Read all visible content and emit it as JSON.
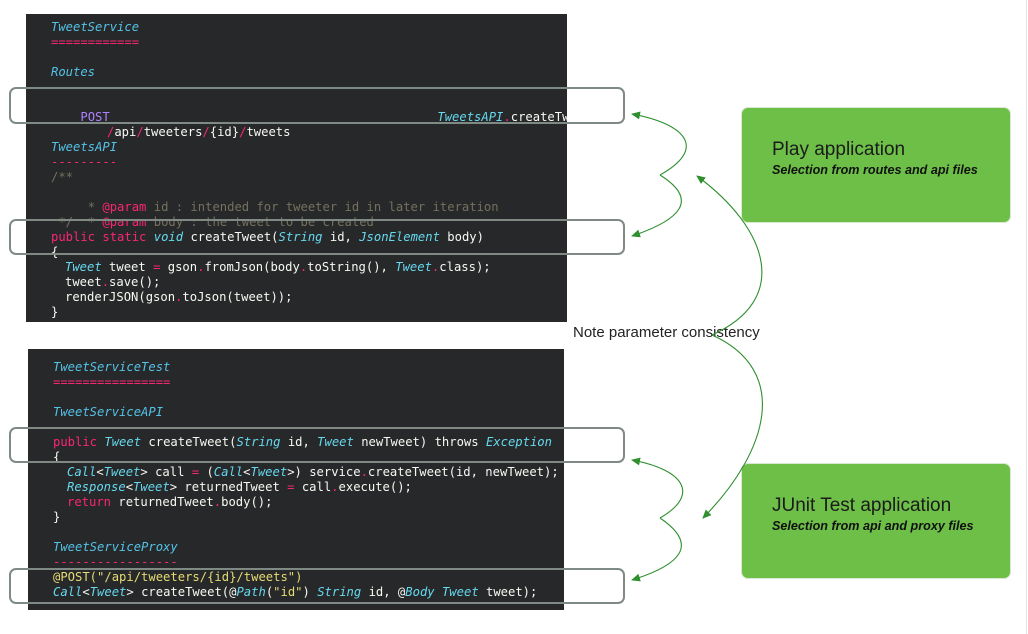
{
  "top_panel": {
    "title": "TweetService",
    "title_underline": "============",
    "routes_heading": "Routes",
    "route_method": "POST",
    "route_path": "/api/tweeters/{id}/tweets",
    "route_target_class": "TweetsAPI",
    "route_target_method": "createTweet",
    "api_heading": "TweetsAPI",
    "api_underline": "---------",
    "comment_open": "/**",
    "param_tag": "@param",
    "param1_text": " id : intended for tweeter id in later iteration",
    "param2_text": " body : the tweet to be created",
    "comment_close": " */",
    "signature": "public static void createTweet(String id, JsonElement body)",
    "brace_open": "{",
    "body_line1": "Tweet tweet = gson.fromJson(body.toString(), Tweet.class);",
    "body_line2": "tweet.save();",
    "body_line3": "renderJSON(gson.toJson(tweet));",
    "brace_close": "}"
  },
  "bottom_panel": {
    "title": "TweetServiceTest",
    "title_underline": "================",
    "api_heading": "TweetServiceAPI",
    "signature": "public Tweet createTweet(String id, Tweet newTweet) throws Exception",
    "brace_open": "{",
    "body_line1": "Call<Tweet> call = (Call<Tweet>) service.createTweet(id, newTweet);",
    "body_line2": "Response<Tweet> returnedTweet = call.execute();",
    "body_line3": "return returnedTweet.body();",
    "brace_close": "}",
    "proxy_heading": "TweetServiceProxy",
    "proxy_underline": "-----------------",
    "annotation_line": "@POST(\"/api/tweeters/{id}/tweets\")",
    "proxy_signature": "Call<Tweet> createTweet(@Path(\"id\") String id, @Body Tweet tweet);"
  },
  "play_box": {
    "title": "Play application",
    "subtitle": "Selection from routes and api files"
  },
  "junit_box": {
    "title": "JUnit Test application",
    "subtitle": "Selection from api and proxy files"
  },
  "note": "Note parameter consistency",
  "colors": {
    "code_background": "#27282a",
    "green_box": "#6dbf48",
    "arrow": "#2f8f2f",
    "highlight_border": "#7f8a84"
  }
}
